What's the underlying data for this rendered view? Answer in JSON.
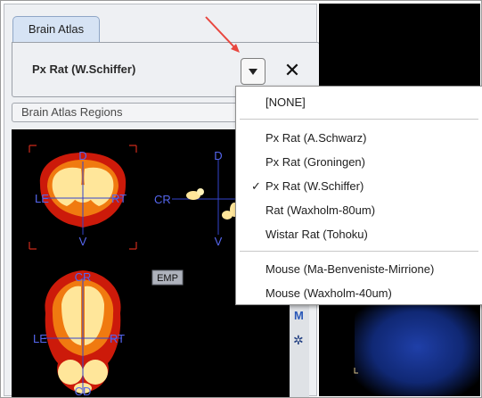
{
  "tab": {
    "label": "Brain Atlas"
  },
  "atlas": {
    "selected": "Px Rat (W.Schiffer)"
  },
  "regions": {
    "label": "Brain Atlas Regions"
  },
  "viewer": {
    "coronal": {
      "top": "D",
      "bottom": "V",
      "left": "LE",
      "right": "RT"
    },
    "sagittal": {
      "top": "D",
      "bottom": "V",
      "left": "CR"
    },
    "axial": {
      "top": "CR",
      "bottom": "CD",
      "left": "LE",
      "right": "RT"
    },
    "emp_label": "EMP"
  },
  "side_toolbar": {
    "m_label": "M"
  },
  "menu": {
    "none": "[NONE]",
    "rat_items": [
      "Px Rat (A.Schwarz)",
      "Px Rat (Groningen)",
      "Px Rat (W.Schiffer)",
      "Rat (Waxholm-80um)",
      "Wistar Rat (Tohoku)"
    ],
    "mouse_items": [
      "Mouse (Ma-Benveniste-Mirrione)",
      "Mouse (Waxholm-40um)"
    ],
    "checked": "Px Rat (W.Schiffer)",
    "check_mark": "✓"
  },
  "icons": [
    "dropdown-arrow-icon",
    "close-icon",
    "annotation-arrow-icon",
    "gear-icon"
  ],
  "colors": {
    "tab_bg": "#d6e3f4",
    "annotation_arrow": "#e8473f",
    "brain_red": "#cc1a0a",
    "brain_orange": "#f07a10",
    "brain_yellow": "#ffe69a",
    "crosshair": "#3344cc"
  }
}
